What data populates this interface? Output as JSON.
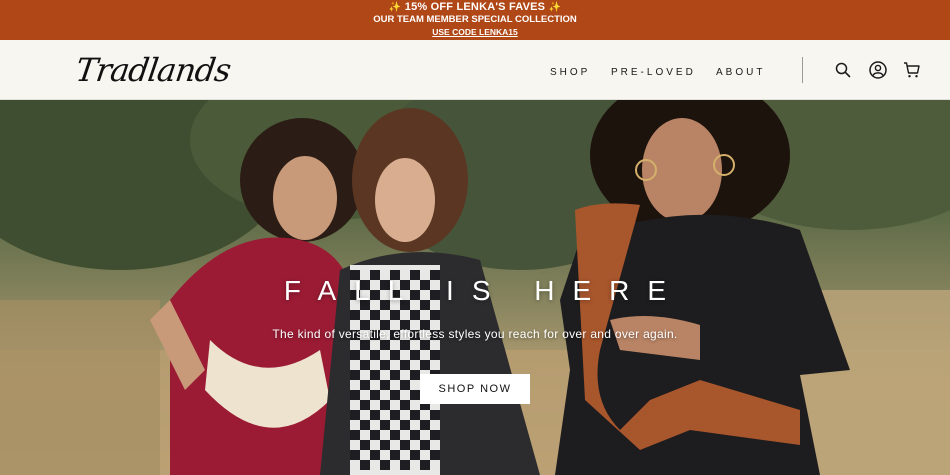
{
  "promo": {
    "headline": "15% OFF LENKA'S FAVES",
    "sparkle": "✨",
    "subline": "OUR TEAM MEMBER SPECIAL COLLECTION",
    "code_link": "USE CODE LENKA15",
    "background": "#b04716"
  },
  "header": {
    "logo": "Tradlands",
    "nav": [
      "SHOP",
      "PRE-LOVED",
      "ABOUT"
    ],
    "icons": [
      "search-icon",
      "account-icon",
      "cart-icon"
    ]
  },
  "hero": {
    "title": "FALL IS HERE",
    "subtitle": "The kind of versatile, effortless styles you reach for over and over again.",
    "cta": "SHOP NOW"
  }
}
